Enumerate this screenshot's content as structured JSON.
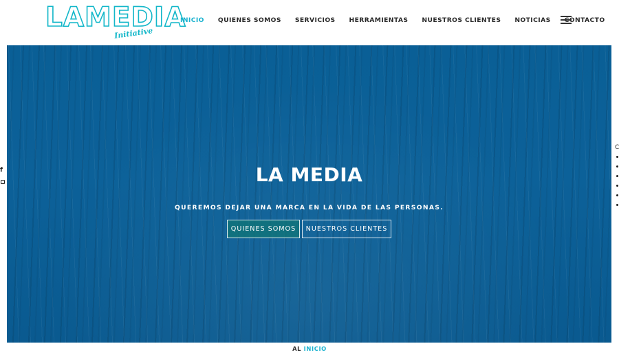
{
  "header": {
    "logo_text": "LAMEDIA",
    "logo_sub": "Initiative",
    "nav": [
      {
        "label": "INICIO",
        "active": true
      },
      {
        "label": "QUIENES SOMOS",
        "active": false
      },
      {
        "label": "SERVICIOS",
        "active": false
      },
      {
        "label": "HERRAMIENTAS",
        "active": false
      },
      {
        "label": "NUESTROS CLIENTES",
        "active": false
      },
      {
        "label": "NOTICIAS",
        "active": false
      },
      {
        "label": "CONTACTO",
        "active": false
      }
    ],
    "menu_icon": "hamburger-icon"
  },
  "hero": {
    "title": "LA MEDIA",
    "subtitle": "QUEREMOS DEJAR UNA MARCA EN LA VIDA DE LAS PERSONAS.",
    "buttons": [
      "QUIENES SOMOS",
      "NUESTROS CLIENTES"
    ]
  },
  "social": {
    "facebook": "f",
    "instagram_icon": "instagram-icon"
  },
  "side_menu": {
    "label": "C"
  },
  "footer": {
    "crumb_prefix": "AL",
    "crumb_link": "INICIO"
  },
  "colors": {
    "accent": "#1ab2cf",
    "hero_bg": "#0b5e95",
    "nav_text": "#2a2a2a"
  }
}
